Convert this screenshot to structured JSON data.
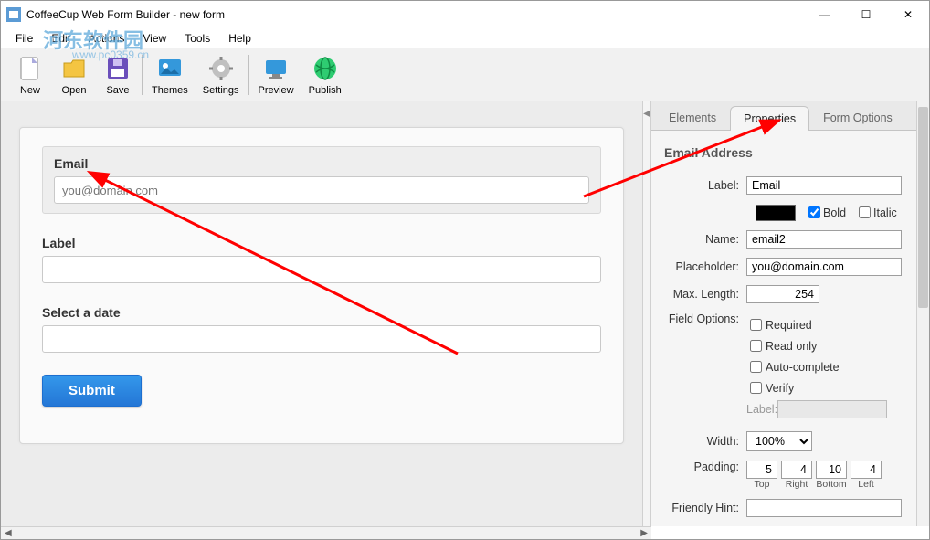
{
  "window": {
    "title": "CoffeeCup Web Form Builder - new form"
  },
  "watermark": {
    "main": "河东软件园",
    "sub": "www.pc0359.cn"
  },
  "menu": {
    "file": "File",
    "edit": "Edit",
    "actions": "Actions",
    "view": "View",
    "tools": "Tools",
    "help": "Help"
  },
  "toolbar": {
    "new": "New",
    "open": "Open",
    "save": "Save",
    "themes": "Themes",
    "settings": "Settings",
    "preview": "Preview",
    "publish": "Publish"
  },
  "form": {
    "email_label": "Email",
    "email_placeholder": "you@domain.com",
    "label_label": "Label",
    "date_label": "Select a date",
    "submit": "Submit"
  },
  "tabs": {
    "elements": "Elements",
    "properties": "Properties",
    "options": "Form Options"
  },
  "props": {
    "title": "Email Address",
    "label_l": "Label:",
    "label_v": "Email",
    "bold": "Bold",
    "italic": "Italic",
    "name_l": "Name:",
    "name_v": "email2",
    "placeholder_l": "Placeholder:",
    "placeholder_v": "you@domain.com",
    "maxlen_l": "Max. Length:",
    "maxlen_v": "254",
    "fieldopts_l": "Field Options:",
    "required": "Required",
    "readonly": "Read only",
    "autocomplete": "Auto-complete",
    "verify": "Verify",
    "vlabel": "Label:",
    "width_l": "Width:",
    "width_v": "100%",
    "padding_l": "Padding:",
    "pad_top": "5",
    "pad_right": "4",
    "pad_bottom": "10",
    "pad_left": "4",
    "pad_top_l": "Top",
    "pad_right_l": "Right",
    "pad_bottom_l": "Bottom",
    "pad_left_l": "Left",
    "hint_l": "Friendly Hint:"
  }
}
